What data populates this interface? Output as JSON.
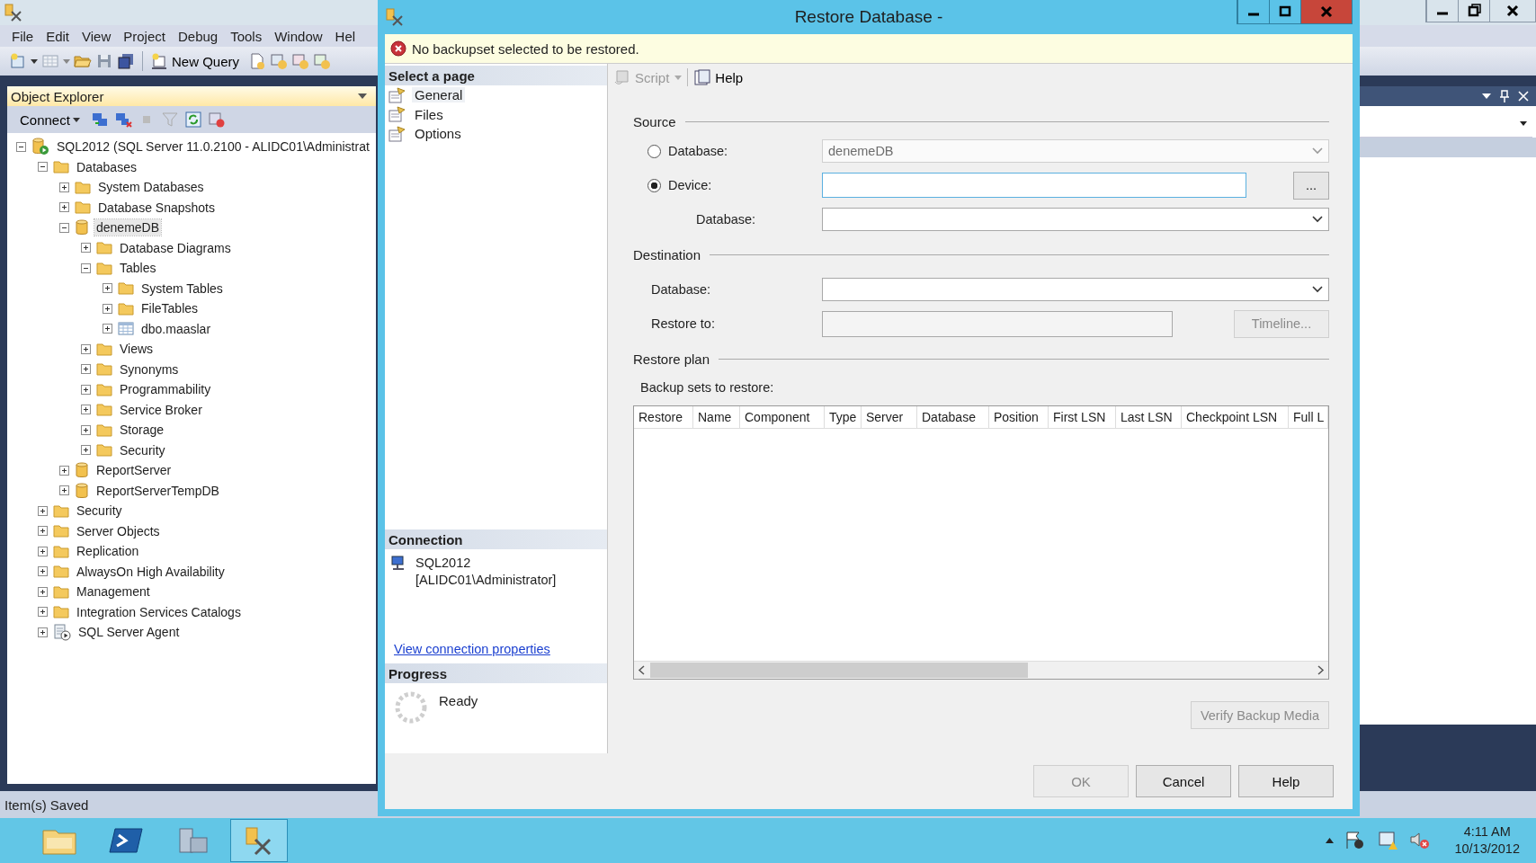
{
  "app": {
    "menu": [
      "File",
      "Edit",
      "View",
      "Project",
      "Debug",
      "Tools",
      "Window",
      "Hel"
    ],
    "toolbar": {
      "new_query": "New Query"
    },
    "object_explorer": {
      "title": "Object Explorer",
      "connect": "Connect",
      "tree": [
        {
          "label": "SQL2012 (SQL Server 11.0.2100 - ALIDC01\\Administrat",
          "kind": "server",
          "expanded": true,
          "selected": false,
          "children": [
            {
              "label": "Databases",
              "kind": "folder",
              "expanded": true,
              "selected": false,
              "children": [
                {
                  "label": "System Databases",
                  "kind": "folder",
                  "expanded": false,
                  "selected": false
                },
                {
                  "label": "Database Snapshots",
                  "kind": "folder",
                  "expanded": false,
                  "selected": false
                },
                {
                  "label": "denemeDB",
                  "kind": "database",
                  "expanded": true,
                  "selected": true,
                  "children": [
                    {
                      "label": "Database Diagrams",
                      "kind": "folder",
                      "expanded": false,
                      "selected": false
                    },
                    {
                      "label": "Tables",
                      "kind": "folder",
                      "expanded": true,
                      "selected": false,
                      "children": [
                        {
                          "label": "System Tables",
                          "kind": "folder",
                          "expanded": false,
                          "selected": false
                        },
                        {
                          "label": "FileTables",
                          "kind": "folder",
                          "expanded": false,
                          "selected": false
                        },
                        {
                          "label": "dbo.maaslar",
                          "kind": "table",
                          "expanded": false,
                          "selected": false
                        }
                      ]
                    },
                    {
                      "label": "Views",
                      "kind": "folder",
                      "expanded": false,
                      "selected": false
                    },
                    {
                      "label": "Synonyms",
                      "kind": "folder",
                      "expanded": false,
                      "selected": false
                    },
                    {
                      "label": "Programmability",
                      "kind": "folder",
                      "expanded": false,
                      "selected": false
                    },
                    {
                      "label": "Service Broker",
                      "kind": "folder",
                      "expanded": false,
                      "selected": false
                    },
                    {
                      "label": "Storage",
                      "kind": "folder",
                      "expanded": false,
                      "selected": false
                    },
                    {
                      "label": "Security",
                      "kind": "folder",
                      "expanded": false,
                      "selected": false
                    }
                  ]
                },
                {
                  "label": "ReportServer",
                  "kind": "database",
                  "expanded": false,
                  "selected": false
                },
                {
                  "label": "ReportServerTempDB",
                  "kind": "database",
                  "expanded": false,
                  "selected": false
                }
              ]
            },
            {
              "label": "Security",
              "kind": "folder",
              "expanded": false,
              "selected": false
            },
            {
              "label": "Server Objects",
              "kind": "folder",
              "expanded": false,
              "selected": false
            },
            {
              "label": "Replication",
              "kind": "folder",
              "expanded": false,
              "selected": false
            },
            {
              "label": "AlwaysOn High Availability",
              "kind": "folder",
              "expanded": false,
              "selected": false
            },
            {
              "label": "Management",
              "kind": "folder",
              "expanded": false,
              "selected": false
            },
            {
              "label": "Integration Services Catalogs",
              "kind": "folder",
              "expanded": false,
              "selected": false
            },
            {
              "label": "SQL Server Agent",
              "kind": "agent",
              "expanded": false,
              "selected": false
            }
          ]
        }
      ]
    },
    "status_bar": "Item(s) Saved"
  },
  "dialog": {
    "title": "Restore Database -",
    "message": "No backupset selected to be restored.",
    "select_page_title": "Select a page",
    "pages": [
      {
        "label": "General",
        "selected": true
      },
      {
        "label": "Files",
        "selected": false
      },
      {
        "label": "Options",
        "selected": false
      }
    ],
    "connection_title": "Connection",
    "connection_lines": [
      "SQL2012",
      "[ALIDC01\\Administrator]"
    ],
    "connection_link": "View connection properties",
    "progress_title": "Progress",
    "progress_status": "Ready",
    "toolbar": {
      "script": "Script",
      "help": "Help"
    },
    "source": {
      "title": "Source",
      "database_option": {
        "label": "Database:",
        "selected": false,
        "value": "denemeDB"
      },
      "device_option": {
        "label": "Device:",
        "selected": true,
        "browse": "..."
      },
      "database_label": "Database:"
    },
    "destination": {
      "title": "Destination",
      "database_label": "Database:",
      "restore_to_label": "Restore to:",
      "timeline": "Timeline..."
    },
    "restore_plan": {
      "title": "Restore plan",
      "backup_sets_label": "Backup sets to restore:",
      "columns": [
        "Restore",
        "Name",
        "Component",
        "Type",
        "Server",
        "Database",
        "Position",
        "First LSN",
        "Last LSN",
        "Checkpoint LSN",
        "Full L"
      ]
    },
    "verify": "Verify Backup Media",
    "buttons": [
      {
        "label": "OK",
        "disabled": true
      },
      {
        "label": "Cancel",
        "disabled": false
      },
      {
        "label": "Help",
        "disabled": false
      }
    ]
  },
  "taskbar": {
    "apps": [
      {
        "kind": "explorer",
        "selected": false
      },
      {
        "kind": "powershell",
        "selected": false
      },
      {
        "kind": "server-manager",
        "selected": false
      },
      {
        "kind": "ssms",
        "selected": true
      }
    ],
    "time": "4:11 AM",
    "date": "10/13/2012"
  }
}
